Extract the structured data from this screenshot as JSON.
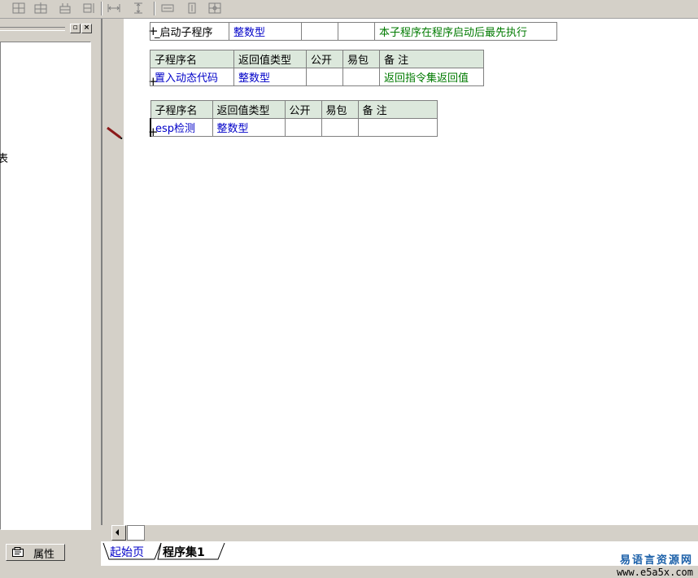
{
  "toolbar": {
    "icons": [
      "insert-column-icon",
      "insert-row-icon",
      "split-cell-icon",
      "merge-cell-icon",
      "align-width-icon",
      "align-height-icon",
      "equal-width-icon",
      "equal-height-icon",
      "table-grid-icon"
    ]
  },
  "left_panel": {
    "partial_text": "表",
    "props_tab_label": "属性"
  },
  "subroutines": [
    {
      "show_header": false,
      "name": "_启动子程序",
      "return_type": "整数型",
      "public": "",
      "easy_pack": "",
      "remark": "本子程序在程序启动后最先执行"
    },
    {
      "show_header": true,
      "name": "置入动态代码",
      "return_type": "整数型",
      "public": "",
      "easy_pack": "",
      "remark": "返回指令集返回值"
    },
    {
      "show_header": true,
      "name": "esp检测",
      "return_type": "整数型",
      "public": "",
      "easy_pack": "",
      "remark": ""
    }
  ],
  "headers": {
    "name": "子程序名",
    "return_type": "返回值类型",
    "public": "公开",
    "easy_pack": "易包",
    "remark": "备 注"
  },
  "expand_symbol": "+",
  "tabs": [
    {
      "label": "起始页",
      "active": false
    },
    {
      "label": "程序集1",
      "active": true
    }
  ],
  "watermark": {
    "cn": "易语言资源网",
    "url": "www.e5a5x.com"
  },
  "colors": {
    "type_text": "#0000c8",
    "remark_text": "#007a00",
    "header_bg": "#dce8dc"
  }
}
